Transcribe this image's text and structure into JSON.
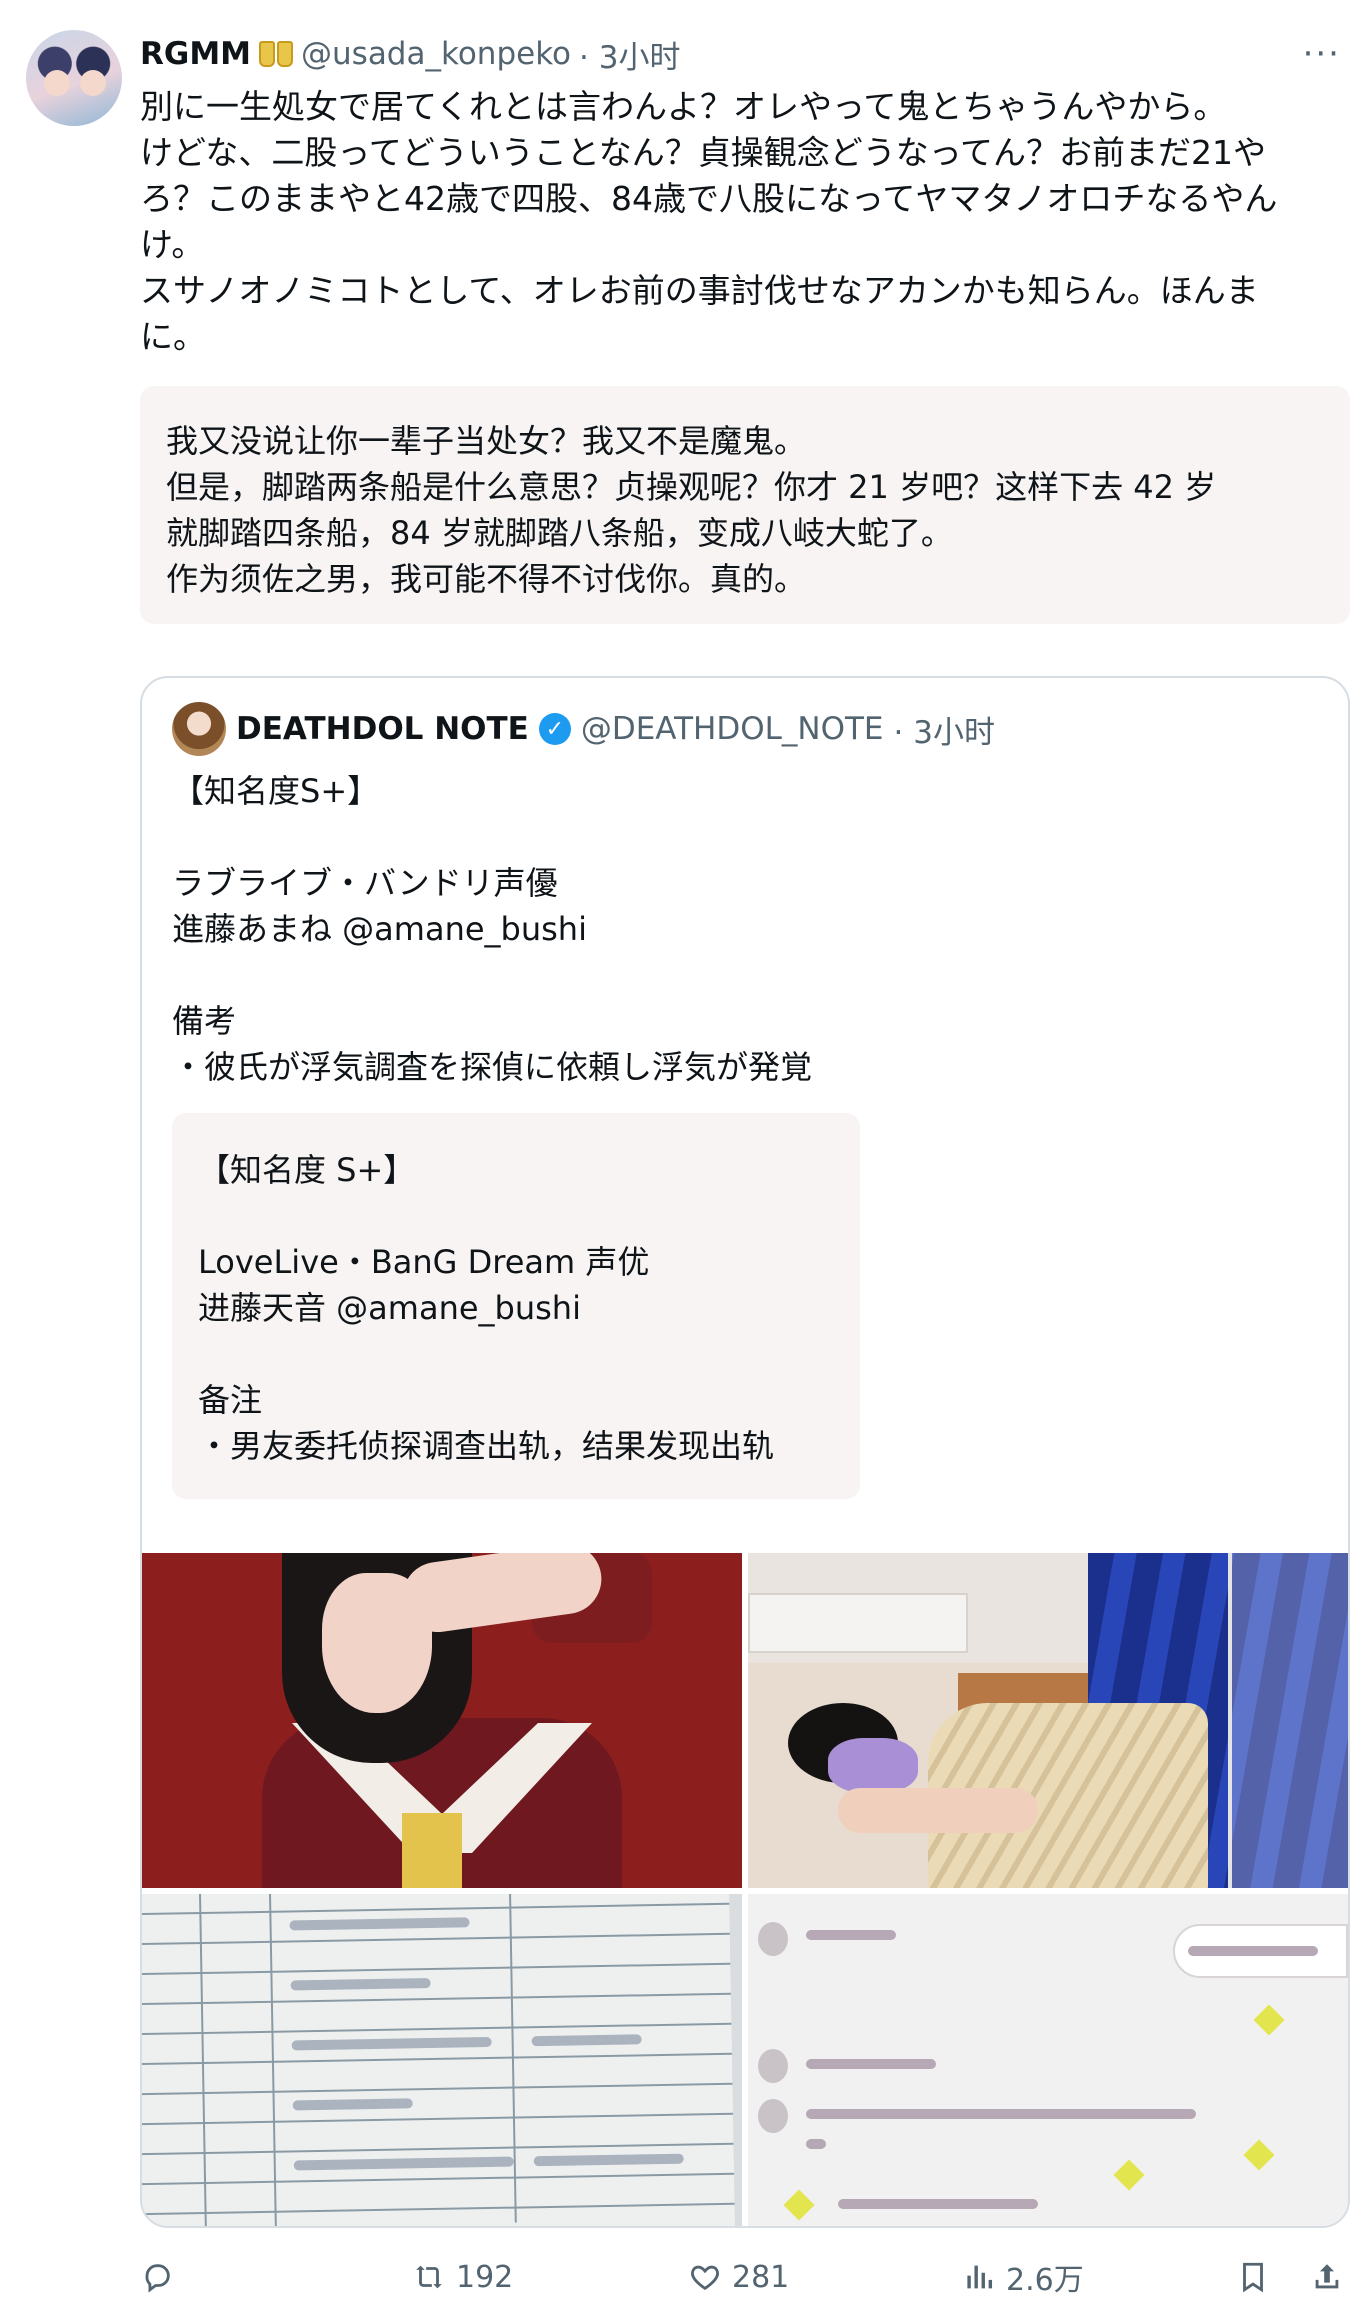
{
  "tweet": {
    "author_name": "RGMM",
    "author_badge_icon": "twin-figures-emoji-icon",
    "author_handle": "@usada_konpeko",
    "timestamp": "· 3小时",
    "more_label": "···",
    "text": "別に一生処女で居てくれとは言わんよ？オレやって鬼とちゃうんやから。\nけどな、二股ってどういうことなん？貞操観念どうなってん？お前まだ21や\nろ？このままやと42歳で四股、84歳で八股になってヤマタノオロチなるやん\nけ。\nスサノオノミコトとして、オレお前の事討伐せなアカンかも知らん。ほんま\nに。",
    "translation": "我又没说让你一辈子当处女？我又不是魔鬼。\n但是，脚踏两条船是什么意思？贞操观呢？你才 21 岁吧？这样下去 42 岁\n就脚踏四条船，84 岁就脚踏八条船，变成八岐大蛇了。\n作为须佐之男，我可能不得不讨伐你。真的。"
  },
  "quote": {
    "author_name": "DEATHDOL NOTE",
    "verified_icon": "verified-check-icon",
    "author_handle": "@DEATHDOL_NOTE",
    "timestamp": "· 3小时",
    "text": "【知名度S+】\n\nラブライブ・バンドリ声優\n進藤あまね @amane_bushi\n\n備考\n・彼氏が浮気調査を探偵に依頼し浮気が発覚",
    "translation": "【知名度 S+】\n\nLoveLive・BanG Dream 声优\n进藤天音 @amane_bushi\n\n备注\n・男友委托侦探调查出轨，结果发现出轨",
    "photos": [
      {
        "name": "photo-girl-in-uniform"
      },
      {
        "name": "photo-girl-sleeping-in-bed"
      },
      {
        "name": "photo-detective-invoice"
      },
      {
        "name": "photo-chat-screenshot"
      }
    ]
  },
  "actions": {
    "reply_count": "",
    "retweet_count": "192",
    "like_count": "281",
    "views_count": "2.6万"
  },
  "colors": {
    "text": "#0f1419",
    "muted": "#536471",
    "verified": "#1d9bf0",
    "translation_bg": "#f7f4f3",
    "border": "#d6dde3"
  }
}
